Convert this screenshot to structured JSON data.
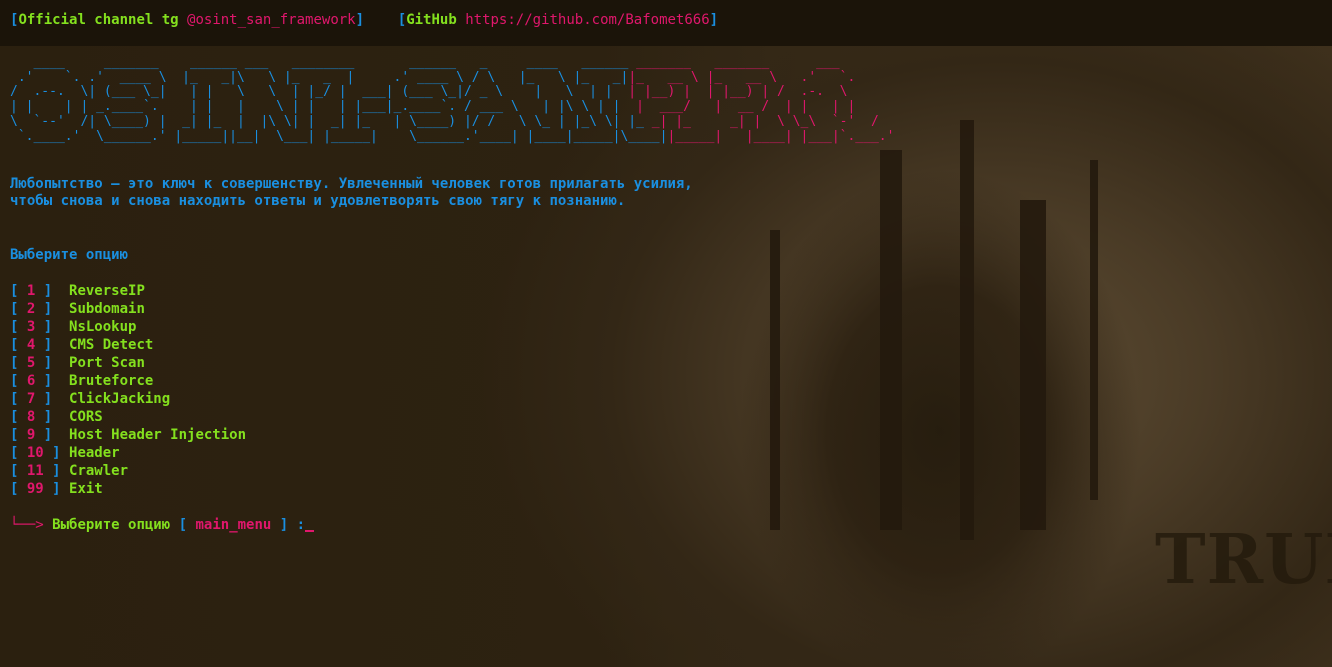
{
  "header": {
    "open_bracket": "[",
    "channel_label": "Official channel tg",
    "channel_handle": "@osint_san_framework",
    "close_bracket": "]",
    "github_open": "[",
    "github_label": "GitHub",
    "github_url": "https://github.com/Bafomet666",
    "github_close": "]"
  },
  "banner": {
    "blue_lines": [
      "   ____     _______    ______ ___   ________       ______   _     ____   ______",
      " .'    `. .'  ____ \\  |_   _|\\   \\ |_   _  |     .' ____ \\ / \\   |_   \\ |_   _|",
      "/  .--.  \\| (___ \\_|   | |   \\   \\  | |_/ |  ___| (___ \\_|/ _ \\    |   \\  | |",
      "| |    | | _.____`.    | |   |    \\ | |   | |___|_.____`. / ___ \\   | |\\ \\ | |",
      "\\  `--'  /| \\____) |  _| |_  |  |\\ \\| |  _| |_   | \\____) |/ /   \\ \\_ | |_\\ \\| |_",
      " `.____.'  \\______.' |_____||__|  \\___| |_____|    \\______.'____| |____|_____|\\____|"
    ],
    "pink_lines": [
      " _______   _______      ___",
      "|_   __ \\ |_   __ \\   .'   `.",
      "  | |__) |  | |__) | /  .-.  \\",
      "  |  ___/   |  __ /  | |   | |",
      " _| |_     _| |  \\ \\_\\  `-'  /",
      "|_____|   |____| |___|`.___.'"
    ]
  },
  "quote": {
    "line1": "Любопытство – это ключ к совершенству. Увлеченный человек готов прилагать усилия,",
    "line2": "чтобы снова и снова находить ответы и удовлетворять свою тягу к познанию."
  },
  "menu_title": "Выберите опцию",
  "options": [
    {
      "number": "1",
      "label": "ReverseIP"
    },
    {
      "number": "2",
      "label": "Subdomain"
    },
    {
      "number": "3",
      "label": "NsLookup"
    },
    {
      "number": "4",
      "label": "CMS Detect"
    },
    {
      "number": "5",
      "label": "Port Scan"
    },
    {
      "number": "6",
      "label": "Bruteforce"
    },
    {
      "number": "7",
      "label": "ClickJacking"
    },
    {
      "number": "8",
      "label": "CORS"
    },
    {
      "number": "9",
      "label": "Host Header Injection"
    },
    {
      "number": "10",
      "label": "Header"
    },
    {
      "number": "11",
      "label": "Crawler"
    },
    {
      "number": "99",
      "label": "Exit"
    }
  ],
  "prompt": {
    "arrow": "└──>",
    "text": "Выберите опцию",
    "open_bracket": "[",
    "context": "main_menu",
    "close_bracket": "]",
    "colon": ":"
  },
  "background_text": "TRUE",
  "colors": {
    "blue": "#1a8fe0",
    "green": "#84e01e",
    "pink": "#e0176c",
    "background": "#2b200f"
  }
}
